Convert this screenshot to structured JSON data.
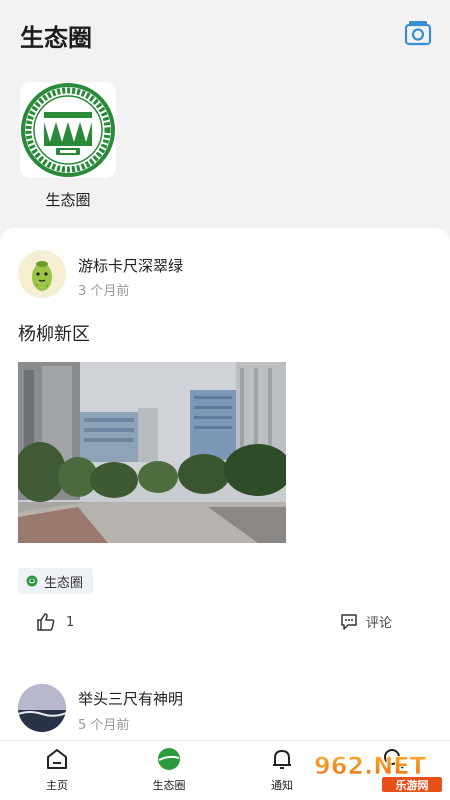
{
  "header": {
    "title": "生态圈",
    "camera_icon": "camera-icon"
  },
  "circles": [
    {
      "name": "生态圈",
      "logo_icon": "school-logo"
    }
  ],
  "posts": [
    {
      "user": "游标卡尺深翠绿",
      "time": "3 个月前",
      "text": "杨柳新区",
      "tag": "生态圈",
      "likes": "1",
      "comment_label": "评论"
    },
    {
      "user": "举头三尺有神明",
      "time": "5 个月前"
    }
  ],
  "tabs": [
    {
      "label": "主页",
      "icon": "home-icon"
    },
    {
      "label": "生态圈",
      "icon": "ecosphere-icon"
    },
    {
      "label": "通知",
      "icon": "bell-icon"
    },
    {
      "label": "",
      "icon": "search-icon"
    }
  ],
  "watermark": {
    "text": "962.NET",
    "subtext": "乐游网"
  },
  "colors": {
    "accent": "#2a9a3c",
    "camera": "#3a8fd0",
    "tag_bg": "#eef1f5"
  }
}
